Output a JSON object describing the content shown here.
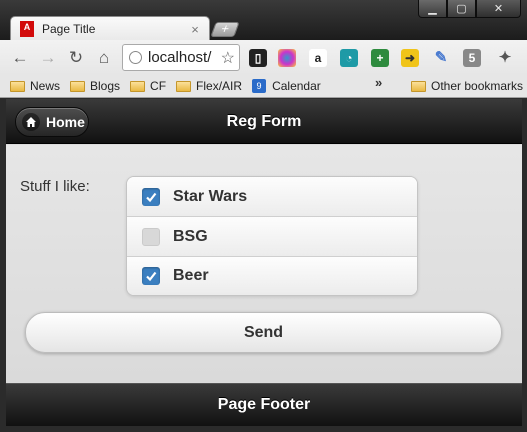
{
  "browser": {
    "tab": {
      "title": "Page Title",
      "favicon_text": "Adobe",
      "close": "×"
    },
    "window_controls": {
      "minimize": "▁",
      "maximize": "▢",
      "close": "✕"
    },
    "address": "localhost/",
    "bookmarks": [
      {
        "label": "News",
        "icon": "folder-icon"
      },
      {
        "label": "Blogs",
        "icon": "folder-icon"
      },
      {
        "label": "CF",
        "icon": "folder-icon"
      },
      {
        "label": "Flex/AIR",
        "icon": "folder-icon"
      },
      {
        "label": "Calendar",
        "icon": "calendar-icon"
      }
    ],
    "overflow": "»",
    "other_bookmarks": "Other bookmarks",
    "calendar_icon_text": "9"
  },
  "page": {
    "header": {
      "home_label": "Home",
      "title": "Reg Form"
    },
    "form": {
      "field_label": "Stuff I like:",
      "choices": [
        {
          "label": "Star Wars",
          "checked": true
        },
        {
          "label": "BSG",
          "checked": false
        },
        {
          "label": "Beer",
          "checked": true
        }
      ],
      "submit_label": "Send"
    },
    "footer": {
      "title": "Page Footer"
    }
  },
  "colors": {
    "checkbox_on": "#3b7fc0",
    "bar_dark": "#1a1a1a",
    "adobe_red": "#d20a0a"
  }
}
